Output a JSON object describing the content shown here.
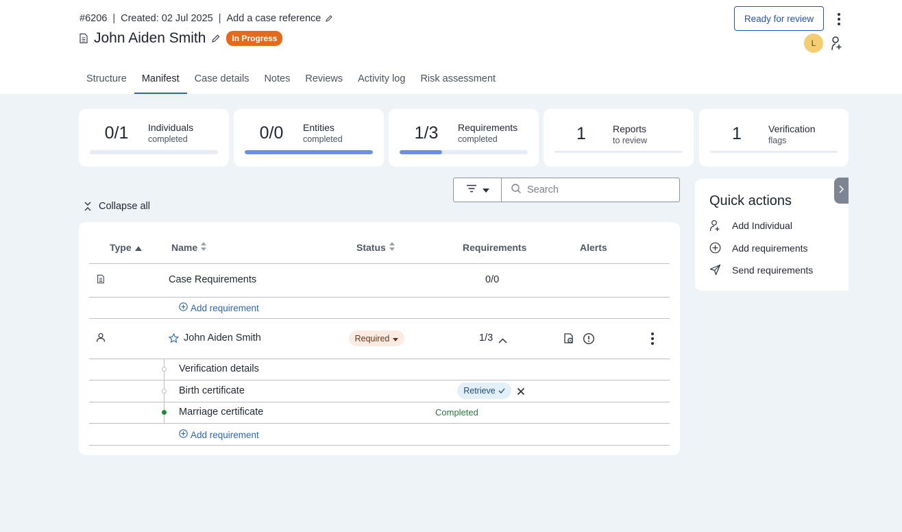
{
  "header": {
    "case_id": "#6206",
    "created": "Created: 02 Jul 2025",
    "case_reference_link": "Add a case reference",
    "title": "John Aiden Smith",
    "status_badge": "In Progress",
    "review_button": "Ready for review",
    "avatar_initial": "L"
  },
  "tabs": [
    {
      "label": "Structure"
    },
    {
      "label": "Manifest",
      "active": true
    },
    {
      "label": "Case details"
    },
    {
      "label": "Notes"
    },
    {
      "label": "Reviews"
    },
    {
      "label": "Activity log"
    },
    {
      "label": "Risk assessment"
    }
  ],
  "stats": [
    {
      "value": "0/1",
      "label": "Individuals",
      "sub": "completed",
      "progress": 0.0
    },
    {
      "value": "0/0",
      "label": "Entities",
      "sub": "completed",
      "progress": 1.0
    },
    {
      "value": "1/3",
      "label": "Requirements",
      "sub": "completed",
      "progress": 0.33
    },
    {
      "value": "1",
      "label": "Reports",
      "sub": "to review"
    },
    {
      "value": "1",
      "label": "Verification",
      "sub": "flags"
    }
  ],
  "toolbar": {
    "search_placeholder": "Search",
    "collapse_label": "Collapse all"
  },
  "table": {
    "columns": [
      "Type",
      "Name",
      "Status",
      "Requirements",
      "Alerts"
    ],
    "case_row": {
      "name": "Case Requirements",
      "requirements": "0/0"
    },
    "add_requirement_label": "Add requirement",
    "person_row": {
      "name": "John Aiden Smith",
      "status": "Required",
      "requirements": "1/3"
    },
    "sub_rows": [
      {
        "name": "Verification details"
      },
      {
        "name": "Birth certificate",
        "action": "Retrieve"
      },
      {
        "name": "Marriage certificate",
        "result": "Completed"
      }
    ]
  },
  "quick_actions": {
    "title": "Quick actions",
    "items": [
      "Add Individual",
      "Add requirements",
      "Send requirements"
    ]
  },
  "colors": {
    "accent": "#2a66b8",
    "badge_in_progress": "#e46b1e",
    "progress_fill": "#6d8ee8",
    "completed_green": "#1f8a3a"
  }
}
